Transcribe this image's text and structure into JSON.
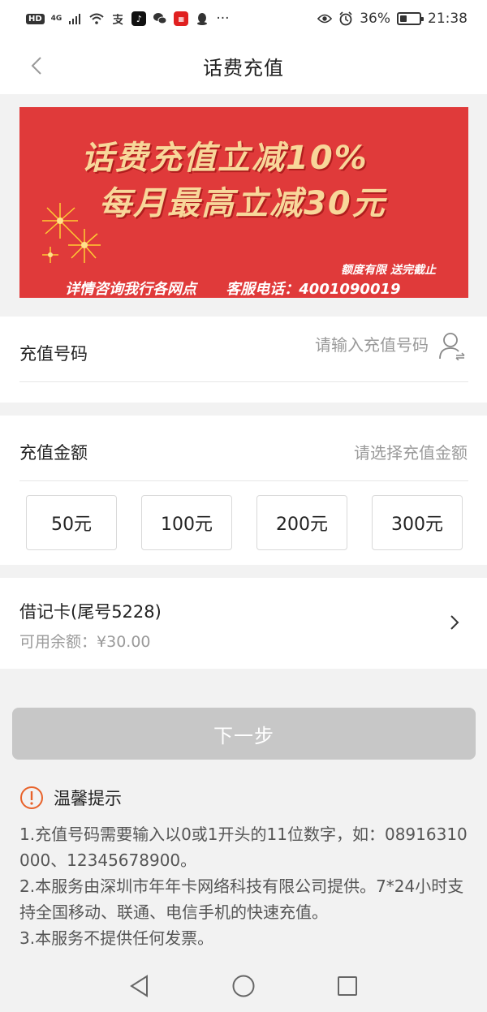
{
  "status_bar": {
    "left_badge": "HD",
    "network": "4G",
    "apps": [
      "wifi-icon",
      "alipay-icon",
      "tiktok-icon",
      "wechat-icon",
      "app-icon",
      "qq-icon"
    ],
    "overflow": "···",
    "battery_percent": "36%",
    "time": "21:38"
  },
  "nav": {
    "title": "话费充值"
  },
  "banner": {
    "line1": "话费充值立减10%",
    "line2": "每月最高立减30元",
    "note": "额度有限 送完截止",
    "footer_left": "详情咨询我行各网点",
    "footer_right": "客服电话：4001090019",
    "colors": {
      "background": "#e03a3a",
      "headline": "#f8d79a"
    }
  },
  "phone": {
    "label": "充值号码",
    "placeholder": "请输入充值号码"
  },
  "amount": {
    "label": "充值金额",
    "placeholder": "请选择充值金额",
    "options": [
      "50元",
      "100元",
      "200元",
      "300元"
    ]
  },
  "payment": {
    "card_name": "借记卡(尾号5228)",
    "balance_label": "可用余额：",
    "balance_value": "¥30.00"
  },
  "next_button": "下一步",
  "tips": {
    "title": "温馨提示",
    "items": [
      "1.充值号码需要输入以0或1开头的11位数字，如：08916310000、12345678900。",
      "2.本服务由深圳市年年卡网络科技有限公司提供。7*24小时支持全国移动、联通、电信手机的快速充值。",
      "3.本服务不提供任何发票。"
    ],
    "accent": "#e8622a"
  }
}
